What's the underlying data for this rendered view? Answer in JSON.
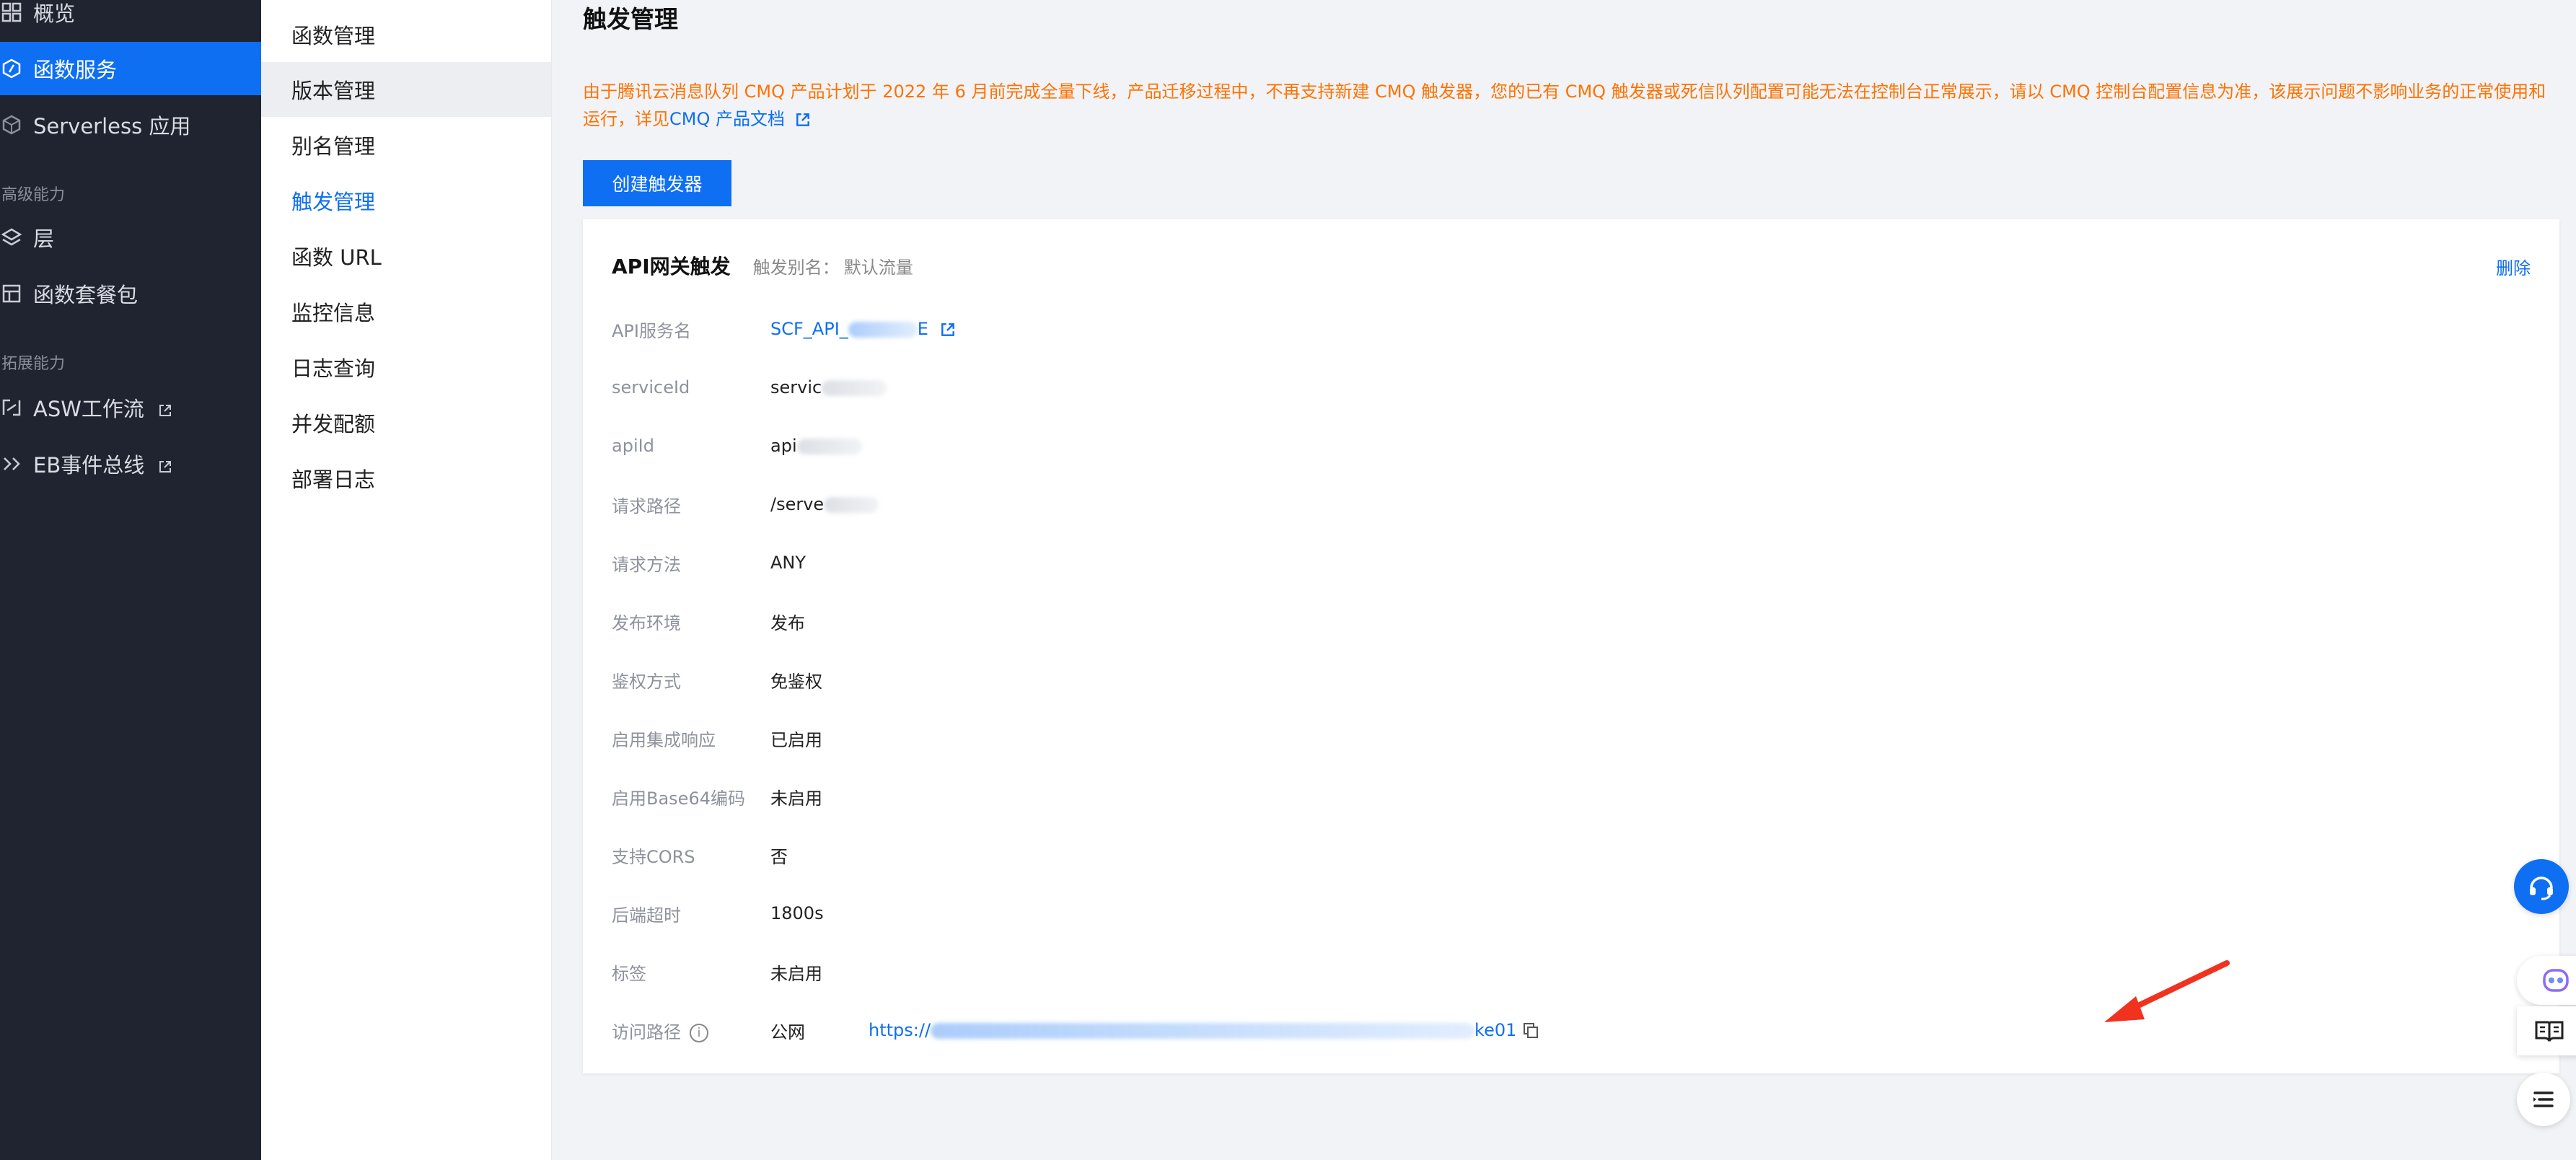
{
  "sidebar": {
    "items": [
      {
        "label": "概览",
        "icon": "grid-icon"
      },
      {
        "label": "函数服务",
        "icon": "function-icon",
        "active": true
      },
      {
        "label": "Serverless 应用",
        "icon": "cube-icon"
      },
      {
        "label": "层",
        "icon": "layers-icon"
      },
      {
        "label": "函数套餐包",
        "icon": "package-icon"
      },
      {
        "label": "ASW工作流",
        "icon": "workflow-icon",
        "external": true
      },
      {
        "label": "EB事件总线",
        "icon": "eventbus-icon",
        "external": true
      }
    ],
    "groups": {
      "advanced": "高级能力",
      "extended": "拓展能力"
    }
  },
  "submenu": {
    "items": [
      "函数管理",
      "版本管理",
      "别名管理",
      "触发管理",
      "函数 URL",
      "监控信息",
      "日志查询",
      "并发配额",
      "部署日志"
    ],
    "active": "触发管理"
  },
  "main": {
    "title": "触发管理",
    "notice": "由于腾讯云消息队列 CMQ 产品计划于 2022 年 6 月前完成全量下线，产品迁移过程中，不再支持新建 CMQ 触发器，您的已有 CMQ 触发器或死信队列配置可能无法在控制台正常展示，请以 CMQ 控制台配置信息为准，该展示问题不影响业务的正常使用和运行，详见",
    "notice_link": "CMQ 产品文档",
    "create_button": "创建触发器"
  },
  "trigger": {
    "title": "API网关触发",
    "alias_label": "触发别名：",
    "alias_value": "默认流量",
    "delete": "删除",
    "rows": [
      {
        "key": "API服务名",
        "value": "SCF_API_",
        "value_tail": "E",
        "link": true
      },
      {
        "key": "serviceId",
        "value": "servic"
      },
      {
        "key": "apiId",
        "value": "api"
      },
      {
        "key": "请求路径",
        "value": "/serve"
      },
      {
        "key": "请求方法",
        "value": "ANY"
      },
      {
        "key": "发布环境",
        "value": "发布"
      },
      {
        "key": "鉴权方式",
        "value": "免鉴权"
      },
      {
        "key": "启用集成响应",
        "value": "已启用"
      },
      {
        "key": "启用Base64编码",
        "value": "未启用"
      },
      {
        "key": "支持CORS",
        "value": "否"
      },
      {
        "key": "后端超时",
        "value": "1800s"
      },
      {
        "key": "标签",
        "value": "未启用"
      }
    ],
    "access": {
      "key": "访问路径",
      "network": "公网",
      "url_head": "https://",
      "url_tail": "ke01"
    }
  },
  "colors": {
    "accent": "#0e6ff3",
    "sidebar_bg": "#1f2430",
    "warning": "#ff7200",
    "arrow": "#f0321e"
  }
}
